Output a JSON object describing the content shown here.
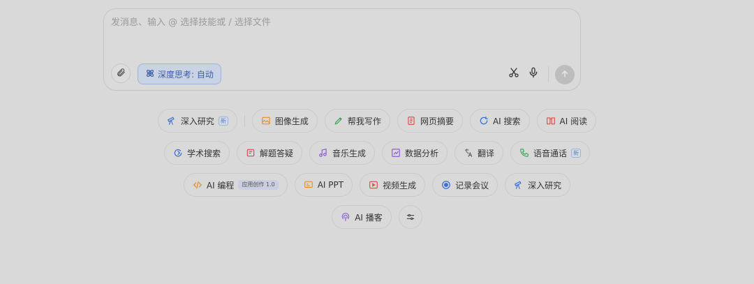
{
  "composer": {
    "placeholder": "发消息、输入 @ 选择技能或 / 选择文件",
    "deep_think_label": "深度思考: 自动"
  },
  "colors": {
    "accent": "#3b5ea6",
    "background": "#d9d9d9"
  },
  "rows": [
    [
      {
        "label": "深入研究",
        "icon": "telescope-icon",
        "badge": "新"
      },
      {
        "label": "图像生成",
        "icon": "image-icon"
      },
      {
        "label": "帮我写作",
        "icon": "pen-icon"
      },
      {
        "label": "网页摘要",
        "icon": "document-icon"
      },
      {
        "label": "AI 搜索",
        "icon": "search-icon"
      },
      {
        "label": "AI 阅读",
        "icon": "book-icon"
      }
    ],
    [
      {
        "label": "学术搜索",
        "icon": "graduation-cap-icon"
      },
      {
        "label": "解题答疑",
        "icon": "question-icon"
      },
      {
        "label": "音乐生成",
        "icon": "music-note-icon"
      },
      {
        "label": "数据分析",
        "icon": "chart-icon"
      },
      {
        "label": "翻译",
        "icon": "translate-icon"
      },
      {
        "label": "语音通话",
        "icon": "phone-icon",
        "badge": "新"
      }
    ],
    [
      {
        "label": "AI 编程",
        "icon": "code-icon",
        "badge_app": "应用创作 1.0"
      },
      {
        "label": "AI PPT",
        "icon": "presentation-icon"
      },
      {
        "label": "视频生成",
        "icon": "video-icon"
      },
      {
        "label": "记录会议",
        "icon": "record-icon"
      },
      {
        "label": "深入研究",
        "icon": "telescope-icon"
      }
    ],
    [
      {
        "label": "AI 播客",
        "icon": "podcast-icon"
      }
    ]
  ]
}
